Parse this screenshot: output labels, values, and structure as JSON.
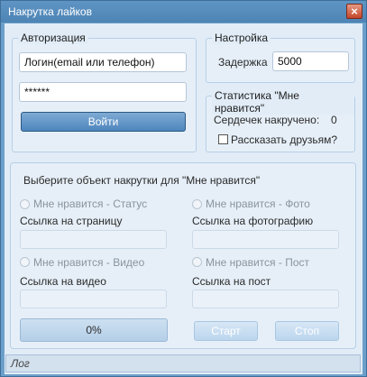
{
  "window": {
    "title": "Накрутка лайков",
    "close_glyph": "×"
  },
  "auth": {
    "legend": "Авторизация",
    "login_value": "Логин(email или телефон)",
    "password_value": "******",
    "login_button": "Войти"
  },
  "settings": {
    "legend": "Настройка",
    "delay_label": "Задержка",
    "delay_value": "5000"
  },
  "stats": {
    "legend": "Статистика \"Мне нравится\"",
    "hearts_label": "Сердечек накручено:",
    "hearts_value": "0",
    "share_label": "Рассказать друзьям?",
    "share_checked": false
  },
  "target": {
    "heading": "Выберите объект накрутки для \"Мне нравится\"",
    "status_option": "Мне нравится - Статус",
    "page_link_label": "Ссылка на страницу",
    "page_link_value": "",
    "photo_option": "Мне нравится - Фото",
    "photo_link_label": "Ссылка на фотографию",
    "photo_link_value": "",
    "video_option": "Мне нравится - Видео",
    "video_link_label": "Ссылка на видео",
    "video_link_value": "",
    "post_option": "Мне нравится - Пост",
    "post_link_label": "Ссылка на пост",
    "post_link_value": ""
  },
  "progress": {
    "value_fraction": 0,
    "text": "0%"
  },
  "buttons": {
    "start": "Старт",
    "stop": "Стоп"
  },
  "status_bar": {
    "log_label": "Лог"
  },
  "colors": {
    "title_bar": "#5589bb",
    "client_bg": "#e1ecf7",
    "primary_button": "#4e86bd",
    "close_button": "#c2452a"
  },
  "icons": {
    "close": "close-icon"
  }
}
